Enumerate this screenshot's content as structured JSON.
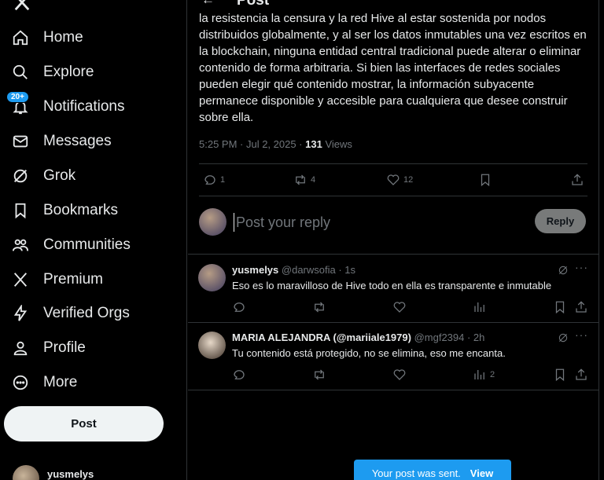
{
  "nav": {
    "items": [
      {
        "label": "Home",
        "icon": "home-icon"
      },
      {
        "label": "Explore",
        "icon": "search-icon"
      },
      {
        "label": "Notifications",
        "icon": "bell-icon",
        "badge": "20+"
      },
      {
        "label": "Messages",
        "icon": "envelope-icon"
      },
      {
        "label": "Grok",
        "icon": "grok-icon"
      },
      {
        "label": "Bookmarks",
        "icon": "bookmark-icon"
      },
      {
        "label": "Communities",
        "icon": "people-icon"
      },
      {
        "label": "Premium",
        "icon": "x-logo-icon"
      },
      {
        "label": "Verified Orgs",
        "icon": "lightning-icon"
      },
      {
        "label": "Profile",
        "icon": "person-icon"
      },
      {
        "label": "More",
        "icon": "more-circle-icon"
      }
    ],
    "post_label": "Post",
    "account_name": "yusmelys"
  },
  "header": {
    "title": "Post"
  },
  "post": {
    "text": "la resistencia la censura y la red Hive al estar sostenida por nodos distribuidos globalmente, y al ser los datos inmutables una vez escritos en la blockchain, ninguna entidad central tradicional puede alterar o eliminar contenido de forma arbitraria. Si bien las interfaces de redes sociales pueden elegir qué contenido mostrar, la información subyacente permanece disponible y accesible para cualquiera que desee construir sobre ella.",
    "timestamp": "5:25 PM · Jul 2, 2025 · ",
    "views_count": "131",
    "views_label": " Views",
    "replies": "1",
    "reposts": "4",
    "likes": "12"
  },
  "composer": {
    "placeholder": "Post your reply",
    "reply_label": "Reply"
  },
  "replies": [
    {
      "name": "yusmelys",
      "handle": "@darwsofia · 1s",
      "text": "Eso es lo maravilloso de Hive todo en ella es transparente e inmutable",
      "views": ""
    },
    {
      "name": "MARIA ALEJANDRA (@mariiale1979)",
      "handle": "@mgf2394 · 2h",
      "text": "Tu contenido está  protegido, no se elimina, eso me encanta.",
      "views": "2"
    }
  ],
  "toast": {
    "text": "Your post was sent.",
    "action": "View"
  },
  "colors": {
    "accent": "#1d9bf0",
    "background": "#000000",
    "muted": "#71767b"
  }
}
